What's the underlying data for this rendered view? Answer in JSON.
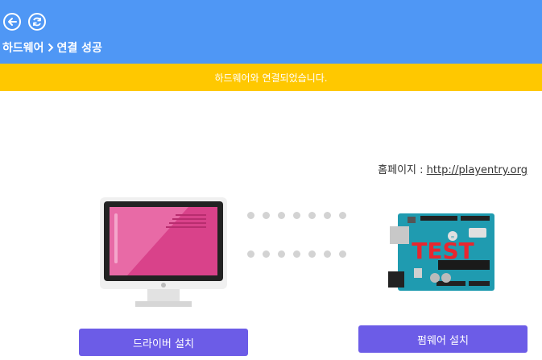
{
  "header": {
    "breadcrumb_root": "하드웨어",
    "breadcrumb_current": "연결 성공",
    "back_icon": "arrow-left-icon",
    "refresh_icon": "refresh-icon"
  },
  "notice": {
    "text": "하드웨어와 연결되었습니다."
  },
  "homepage": {
    "label": "홈페이지 : ",
    "url": "http://playentry.org"
  },
  "board_overlay_text": "TEST",
  "buttons": {
    "driver_install": "드라이버 설치",
    "firmware_install": "펌웨어 설치"
  },
  "colors": {
    "header": "#4f97f5",
    "notice": "#ffc800",
    "button": "#6c5ce7",
    "board": "#1f9bb0",
    "test_text": "#e8262e"
  }
}
